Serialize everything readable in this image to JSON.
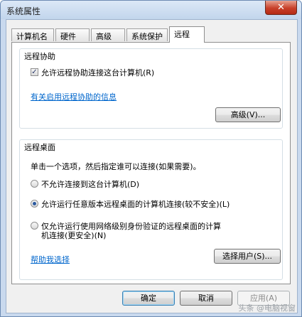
{
  "window": {
    "title": "系统属性",
    "close_glyph": "✕"
  },
  "tabs": [
    {
      "label": "计算机名"
    },
    {
      "label": "硬件"
    },
    {
      "label": "高级"
    },
    {
      "label": "系统保护"
    },
    {
      "label": "远程",
      "active": true
    }
  ],
  "remote_assistance": {
    "title": "远程协助",
    "checkbox_label": "允许远程协助连接这台计算机(R)",
    "checked": true,
    "info_link": "有关启用远程协助的信息",
    "advanced_button": "高级(V)..."
  },
  "remote_desktop": {
    "title": "远程桌面",
    "instruction": "单击一个选项，然后指定谁可以连接(如果需要)。",
    "options": [
      {
        "label": "不允许连接到这台计算机(D)",
        "selected": false
      },
      {
        "label": "允许运行任意版本远程桌面的计算机连接(较不安全)(L)",
        "selected": true
      },
      {
        "label_line1": "仅允许运行使用网络级别身份验证的远程桌面的计算",
        "label_line2": "机连接(更安全)(N)",
        "selected": false
      }
    ],
    "help_link": "帮助我选择",
    "select_users_button": "选择用户(S)..."
  },
  "footer": {
    "ok": "确定",
    "cancel": "取消",
    "apply": "应用(A)"
  },
  "watermark": "头条 @电脑视窗"
}
